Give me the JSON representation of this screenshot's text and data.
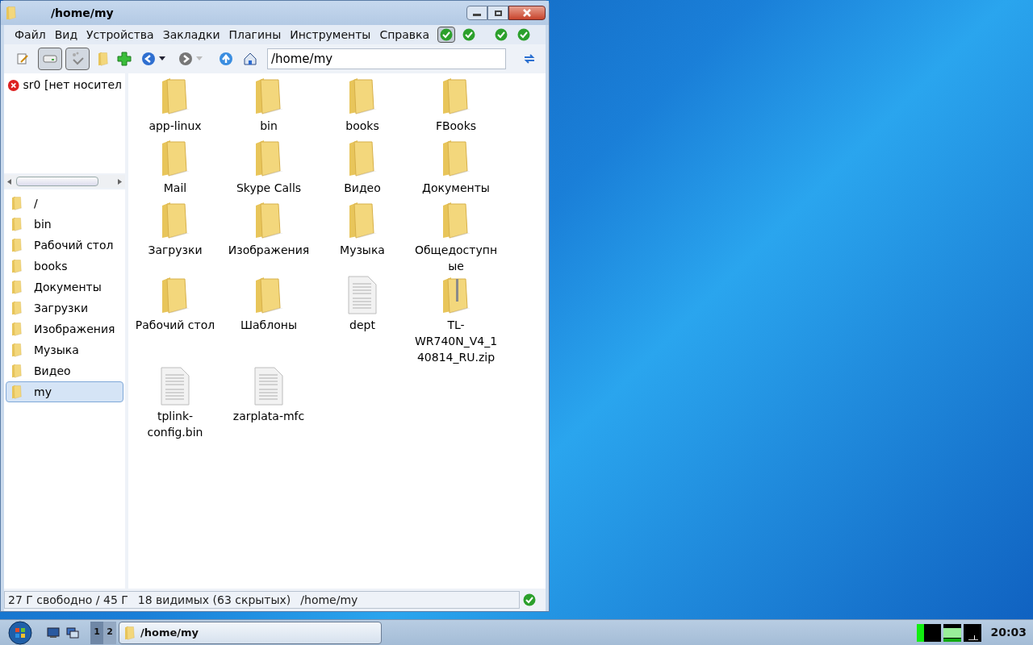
{
  "window": {
    "title": "/home/my"
  },
  "menu": [
    "Файл",
    "Вид",
    "Устройства",
    "Закладки",
    "Плагины",
    "Инструменты",
    "Справка"
  ],
  "menu_toggles": [
    {
      "pressed": true
    },
    {
      "pressed": false
    },
    {
      "pressed": false
    },
    {
      "pressed": false
    }
  ],
  "toolbar": [
    {
      "pressed": false
    },
    {
      "pressed": true
    },
    {
      "pressed": true
    }
  ],
  "location": {
    "value": "/home/my"
  },
  "devices": [
    {
      "label": "sr0 [нет носител"
    }
  ],
  "places": [
    {
      "label": "/",
      "selected": false
    },
    {
      "label": "bin",
      "selected": false
    },
    {
      "label": "Рабочий стол",
      "selected": false
    },
    {
      "label": "books",
      "selected": false
    },
    {
      "label": "Документы",
      "selected": false
    },
    {
      "label": "Загрузки",
      "selected": false
    },
    {
      "label": "Изображения",
      "selected": false
    },
    {
      "label": "Музыка",
      "selected": false
    },
    {
      "label": "Видео",
      "selected": false
    },
    {
      "label": "my",
      "selected": true
    }
  ],
  "files": [
    {
      "name": "app-linux",
      "kind": "folder"
    },
    {
      "name": "bin",
      "kind": "folder"
    },
    {
      "name": "books",
      "kind": "folder"
    },
    {
      "name": "FBooks",
      "kind": "folder"
    },
    {
      "name": "Mail",
      "kind": "folder"
    },
    {
      "name": "Skype Calls",
      "kind": "folder"
    },
    {
      "name": "Видео",
      "kind": "folder"
    },
    {
      "name": "Документы",
      "kind": "folder"
    },
    {
      "name": "Загрузки",
      "kind": "folder"
    },
    {
      "name": "Изображения",
      "kind": "folder"
    },
    {
      "name": "Музыка",
      "kind": "folder"
    },
    {
      "name": "Общедоступные",
      "kind": "folder"
    },
    {
      "name": "Рабочий стол",
      "kind": "folder"
    },
    {
      "name": "Шаблоны",
      "kind": "folder"
    },
    {
      "name": "dept",
      "kind": "file"
    },
    {
      "name": "TL-WR740N_V4_140814_RU.zip",
      "kind": "zip"
    },
    {
      "name": "tplink-config.bin",
      "kind": "file"
    },
    {
      "name": "zarplata-mfc",
      "kind": "file"
    }
  ],
  "status_bar": {
    "free": "27 Г свободно / 45 Г",
    "count": "18 видимых (63 скрытых)",
    "path": "/home/my"
  },
  "taskbar": {
    "desktops": [
      {
        "label": "1",
        "selected": true
      },
      {
        "label": "2",
        "selected": false
      }
    ],
    "task": "/home/my",
    "clock": "20:03"
  }
}
